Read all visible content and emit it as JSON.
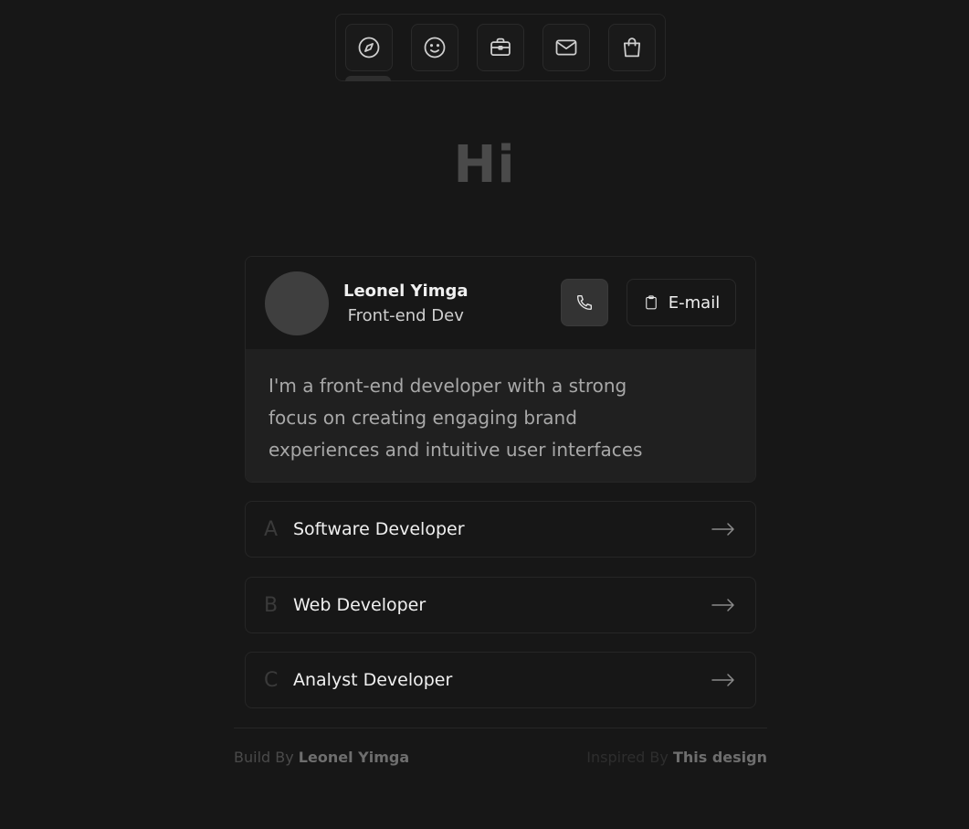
{
  "nav": {
    "items": [
      {
        "icon": "compass-icon",
        "active": true
      },
      {
        "icon": "smile-icon"
      },
      {
        "icon": "briefcase-icon"
      },
      {
        "icon": "mail-icon"
      },
      {
        "icon": "shopping-bag-icon"
      }
    ]
  },
  "hero": {
    "greeting": "Hi"
  },
  "profile": {
    "name": "Leonel Yimga",
    "role": "Front-end Dev",
    "email_label": "E-mail",
    "bio": "I'm a front-end developer with a strong focus on creating engaging brand experiences and intuitive user interfaces"
  },
  "jobs": [
    {
      "letter": "A",
      "title": "Software Developer"
    },
    {
      "letter": "B",
      "title": "Web Developer"
    },
    {
      "letter": "C",
      "title": "Analyst Developer"
    }
  ],
  "footer": {
    "build_prefix": "Build By",
    "build_name": "Leonel Yimga",
    "inspired_prefix": "Inspired By",
    "inspired_link": "This design"
  },
  "colors": {
    "background": "#171717",
    "card_body": "#202020",
    "border": "#262626"
  }
}
